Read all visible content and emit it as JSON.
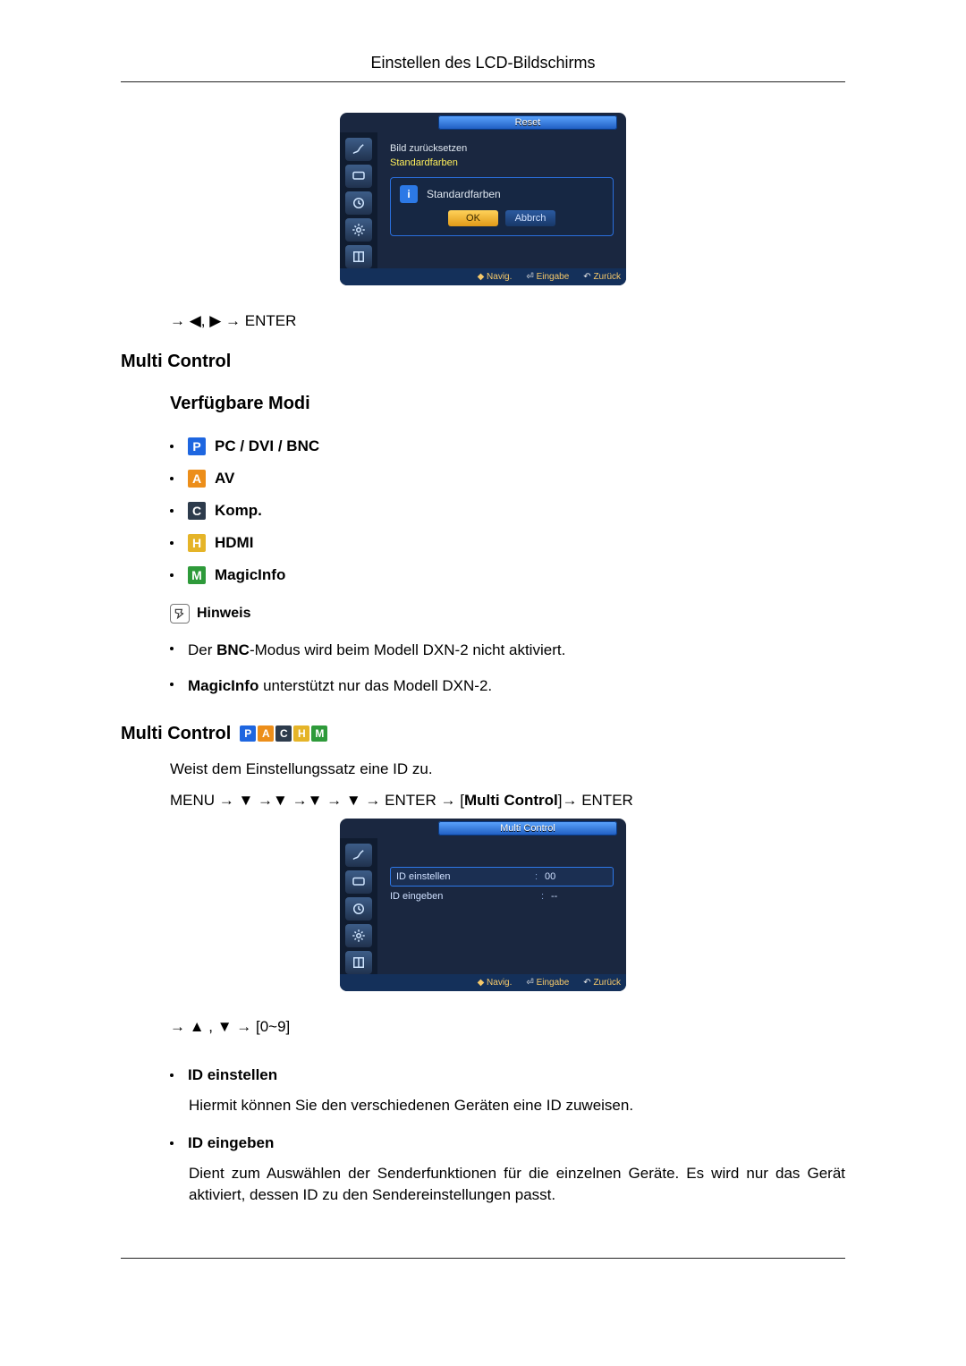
{
  "header": {
    "title": "Einstellen des LCD-Bildschirms"
  },
  "osd1": {
    "title": "Reset",
    "line1": "Bild zurücksetzen",
    "line2": "Standardfarben",
    "dialog_label": "Standardfarben",
    "ok": "OK",
    "cancel": "Abbrch",
    "footer": {
      "nav": "Navig.",
      "enter": "Eingabe",
      "back": "Zurück"
    }
  },
  "seq1": "→ ◀, ▶ → ENTER",
  "h1a": "Multi Control",
  "h2a": "Verfügbare Modi",
  "modes": {
    "p": "PC / DVI / BNC",
    "a": "AV",
    "c": "Komp.",
    "h": "HDMI",
    "m": "MagicInfo"
  },
  "note_label": "Hinweis",
  "notes": {
    "n1_pre": "Der ",
    "n1_bold": "BNC",
    "n1_post": "-Modus wird beim Modell DXN-2 nicht aktiviert.",
    "n2_bold": "MagicInfo",
    "n2_post": " unterstützt nur das Modell DXN-2."
  },
  "h1b": "Multi Control",
  "para_assign": "Weist dem Einstellungssatz eine ID zu.",
  "menu_seq": {
    "pre": "MENU → ▼ →▼ →▼ → ▼ → ENTER → [",
    "label": "Multi Control",
    "post": "]→ ENTER"
  },
  "osd2": {
    "title": "Multi Control",
    "row1_label": "ID einstellen",
    "row1_val": "00",
    "row2_label": "ID eingeben",
    "row2_val": "--",
    "footer": {
      "nav": "Navig.",
      "enter": "Eingabe",
      "back": "Zurück"
    }
  },
  "seq2": "→ ▲ , ▼ → [0~9]",
  "items": {
    "set_id": {
      "label": "ID einstellen",
      "desc": "Hiermit können Sie den verschiedenen Geräten eine ID zuweisen."
    },
    "enter_id": {
      "label": "ID eingeben",
      "desc": "Dient zum Auswählen der Senderfunktionen für die einzelnen Geräte. Es wird nur das Gerät aktiviert, dessen ID zu den Sendereinstellungen passt."
    }
  }
}
